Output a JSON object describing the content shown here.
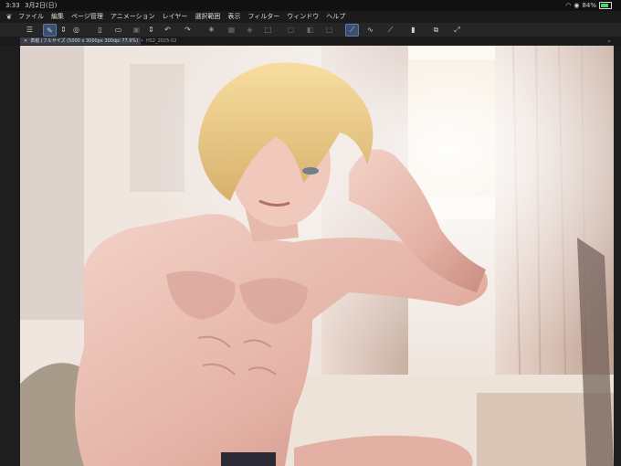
{
  "status": {
    "time": "3:33",
    "date": "3月2日(日)",
    "battery": "84%"
  },
  "menu": {
    "items": [
      "ファイル",
      "編集",
      "ページ管理",
      "アニメーション",
      "レイヤー",
      "選択範囲",
      "表示",
      "フィルター",
      "ウィンドウ",
      "ヘルプ"
    ]
  },
  "tabs": {
    "active": "表紙 (フルサイズ (5000 x 3000px 300dpi 77.9%)",
    "inactive": "HS2_2025-02"
  },
  "colors": {
    "accent": "#5b7bb0",
    "background": "#1e1e1e"
  }
}
